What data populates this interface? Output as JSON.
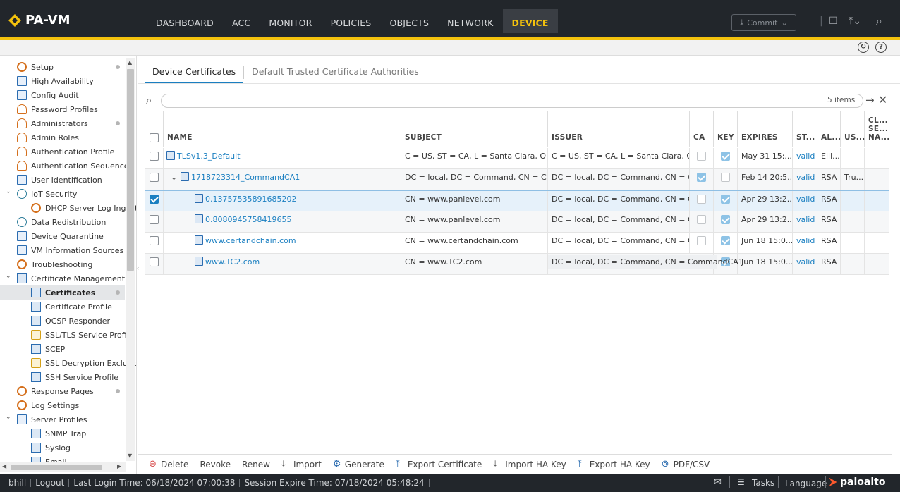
{
  "app": {
    "name": "PA-VM"
  },
  "nav": {
    "tabs": [
      "DASHBOARD",
      "ACC",
      "MONITOR",
      "POLICIES",
      "OBJECTS",
      "NETWORK",
      "DEVICE"
    ],
    "active": "DEVICE",
    "commit_label": "Commit"
  },
  "sidebar": {
    "items": [
      {
        "label": "Setup",
        "icon": "gear-icon",
        "level": 1,
        "dot": true
      },
      {
        "label": "High Availability",
        "icon": "ha-icon",
        "level": 1
      },
      {
        "label": "Config Audit",
        "icon": "audit-icon",
        "level": 1
      },
      {
        "label": "Password Profiles",
        "icon": "password-icon",
        "level": 1
      },
      {
        "label": "Administrators",
        "icon": "admin-icon",
        "level": 1,
        "dot": true
      },
      {
        "label": "Admin Roles",
        "icon": "role-icon",
        "level": 1
      },
      {
        "label": "Authentication Profile",
        "icon": "auth-profile-icon",
        "level": 1
      },
      {
        "label": "Authentication Sequence",
        "icon": "auth-sequence-icon",
        "level": 1
      },
      {
        "label": "User Identification",
        "icon": "user-id-icon",
        "level": 1
      },
      {
        "label": "IoT Security",
        "icon": "iot-icon",
        "level": 1,
        "expanded": true
      },
      {
        "label": "DHCP Server Log Ingestion",
        "icon": "dhcp-icon",
        "level": 2
      },
      {
        "label": "Data Redistribution",
        "icon": "redistribution-icon",
        "level": 1
      },
      {
        "label": "Device Quarantine",
        "icon": "quarantine-icon",
        "level": 1
      },
      {
        "label": "VM Information Sources",
        "icon": "vm-icon",
        "level": 1
      },
      {
        "label": "Troubleshooting",
        "icon": "troubleshoot-icon",
        "level": 1
      },
      {
        "label": "Certificate Management",
        "icon": "cert-mgmt-icon",
        "level": 1,
        "expanded": true
      },
      {
        "label": "Certificates",
        "icon": "certificate-icon",
        "level": 2,
        "selected": true,
        "dot": true
      },
      {
        "label": "Certificate Profile",
        "icon": "cert-profile-icon",
        "level": 2
      },
      {
        "label": "OCSP Responder",
        "icon": "ocsp-icon",
        "level": 2
      },
      {
        "label": "SSL/TLS Service Profile",
        "icon": "ssl-lock-icon",
        "level": 2
      },
      {
        "label": "SCEP",
        "icon": "scep-icon",
        "level": 2
      },
      {
        "label": "SSL Decryption Exclusion",
        "icon": "ssl-exclusion-icon",
        "level": 2
      },
      {
        "label": "SSH Service Profile",
        "icon": "ssh-icon",
        "level": 2
      },
      {
        "label": "Response Pages",
        "icon": "response-icon",
        "level": 1,
        "dot": true
      },
      {
        "label": "Log Settings",
        "icon": "log-icon",
        "level": 1
      },
      {
        "label": "Server Profiles",
        "icon": "server-icon",
        "level": 1,
        "expanded": true
      },
      {
        "label": "SNMP Trap",
        "icon": "snmp-icon",
        "level": 2
      },
      {
        "label": "Syslog",
        "icon": "syslog-icon",
        "level": 2
      },
      {
        "label": "Email",
        "icon": "email-icon",
        "level": 2
      }
    ]
  },
  "tabs": [
    {
      "label": "Device Certificates",
      "active": true
    },
    {
      "label": "Default Trusted Certificate Authorities",
      "active": false
    }
  ],
  "filter": {
    "value": "",
    "count": "5 items"
  },
  "table": {
    "headers": [
      "NAME",
      "SUBJECT",
      "ISSUER",
      "CA",
      "KEY",
      "EXPIRES",
      "ST...",
      "AL...",
      "US...",
      "CL... SE... NA..."
    ],
    "rows": [
      {
        "name": "TLSv1.3_Default",
        "subject": "C = US, ST = CA, L = Santa Clara, O = P...",
        "issuer": "C = US, ST = CA, L = Santa Clara, O = ...",
        "ca": false,
        "key": true,
        "expires": "May 31 15:...",
        "status": "valid",
        "algorithm": "Elli...",
        "usage": "",
        "indent": 0,
        "expander": false,
        "checked": false
      },
      {
        "name": "1718723314_CommandCA1",
        "subject": "DC = local, DC = Command, CN = Com...",
        "issuer": "DC = local, DC = Command, CN = Co...",
        "ca": true,
        "key": false,
        "expires": "Feb 14 20:5...",
        "status": "valid",
        "algorithm": "RSA",
        "usage": "Tru...",
        "indent": 1,
        "expander": true,
        "checked": false
      },
      {
        "name": "0.13757535891685202",
        "subject": "CN = www.panlevel.com",
        "issuer": "DC = local, DC = Command, CN = Co...",
        "ca": false,
        "key": true,
        "expires": "Apr 29 13:2...",
        "status": "valid",
        "algorithm": "RSA",
        "usage": "",
        "indent": 2,
        "expander": false,
        "checked": true
      },
      {
        "name": "0.8080945758419655",
        "subject": "CN = www.panlevel.com",
        "issuer": "DC = local, DC = Command, CN = Co...",
        "ca": false,
        "key": true,
        "expires": "Apr 29 13:2...",
        "status": "valid",
        "algorithm": "RSA",
        "usage": "",
        "indent": 2,
        "expander": false,
        "checked": false
      },
      {
        "name": "www.certandchain.com",
        "subject": "CN = www.certandchain.com",
        "issuer": "DC = local, DC = Command, CN = Co...",
        "ca": false,
        "key": true,
        "expires": "Jun 18 15:0...",
        "status": "valid",
        "algorithm": "RSA",
        "usage": "",
        "indent": 2,
        "expander": false,
        "checked": false
      },
      {
        "name": "www.TC2.com",
        "subject": "CN = www.TC2.com",
        "issuer": "DC = local, DC = Command, CN = CommandCA1",
        "ca": false,
        "key": true,
        "expires": "Jun 18 15:0...",
        "status": "valid",
        "algorithm": "RSA",
        "usage": "",
        "indent": 2,
        "expander": false,
        "checked": false
      }
    ]
  },
  "actions": [
    {
      "label": "Delete",
      "icon": "delete-icon"
    },
    {
      "label": "Revoke",
      "icon": ""
    },
    {
      "label": "Renew",
      "icon": ""
    },
    {
      "label": "Import",
      "icon": "import-icon"
    },
    {
      "label": "Generate",
      "icon": "generate-icon"
    },
    {
      "label": "Export Certificate",
      "icon": "export-icon"
    },
    {
      "label": "Import HA Key",
      "icon": "import-ha-icon"
    },
    {
      "label": "Export HA Key",
      "icon": "export-ha-icon"
    },
    {
      "label": "PDF/CSV",
      "icon": "pdf-csv-icon"
    }
  ],
  "status": {
    "user": "bhill",
    "logout": "Logout",
    "last_login": "Last Login Time: 06/18/2024 07:00:38",
    "session_expire": "Session Expire Time: 07/18/2024 05:48:24",
    "tasks": "Tasks",
    "language": "Language",
    "brand": "paloalto"
  },
  "colors": {
    "accent": "#f4c20d",
    "link": "#1a7fc1",
    "topbar": "#22262b"
  }
}
